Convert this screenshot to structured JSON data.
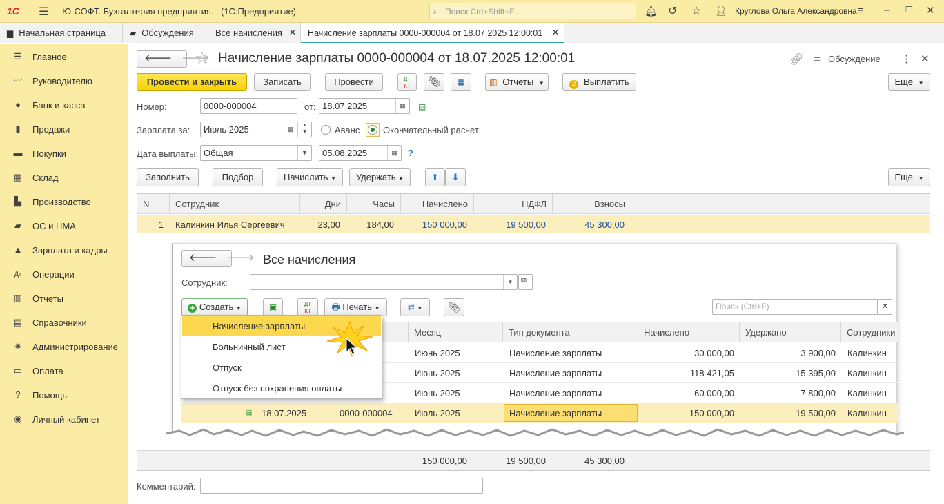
{
  "app": {
    "logo": "1С",
    "title": "Ю-СОФТ. Бухгалтерия предприятия.",
    "platform": "(1С:Предприятие)",
    "search_placeholder": "Поиск Ctrl+Shift+F",
    "user": "Круглова Ольга Александровна"
  },
  "tabs": [
    {
      "label": "Начальная страница"
    },
    {
      "label": "Обсуждения"
    },
    {
      "label": "Все начисления"
    },
    {
      "label": "Начисление зарплаты 0000-000004 от 18.07.2025 12:00:01"
    }
  ],
  "sidebar": {
    "items": [
      {
        "label": "Главное",
        "icon": "menu-icon"
      },
      {
        "label": "Руководителю",
        "icon": "trend-icon"
      },
      {
        "label": "Банк и касса",
        "icon": "coin-icon"
      },
      {
        "label": "Продажи",
        "icon": "bag-icon"
      },
      {
        "label": "Покупки",
        "icon": "cart-icon"
      },
      {
        "label": "Склад",
        "icon": "warehouse-icon"
      },
      {
        "label": "Производство",
        "icon": "factory-icon"
      },
      {
        "label": "ОС и НМА",
        "icon": "truck-icon"
      },
      {
        "label": "Зарплата и кадры",
        "icon": "person-icon"
      },
      {
        "label": "Операции",
        "icon": "dt-kt-icon"
      },
      {
        "label": "Отчеты",
        "icon": "chart-icon"
      },
      {
        "label": "Справочники",
        "icon": "book-icon"
      },
      {
        "label": "Администрирование",
        "icon": "gear-icon"
      },
      {
        "label": "Оплата",
        "icon": "card-icon"
      },
      {
        "label": "Помощь",
        "icon": "question-icon"
      },
      {
        "label": "Личный кабинет",
        "icon": "account-icon"
      }
    ]
  },
  "doc": {
    "title": "Начисление зарплаты 0000-000004 от 18.07.2025 12:00:01",
    "discussion": "Обсуждение",
    "buttons": {
      "post_close": "Провести и закрыть",
      "save": "Записать",
      "post": "Провести",
      "reports": "Отчеты",
      "pay": "Выплатить",
      "more": "Еще"
    },
    "fields": {
      "number_label": "Номер:",
      "number": "0000-000004",
      "date_label": "от:",
      "date": "18.07.2025",
      "salary_for_label": "Зарплата за:",
      "salary_for": "Июль 2025",
      "advance": "Аванс",
      "final_calc": "Окончательный расчет",
      "pay_date_label": "Дата выплаты:",
      "pay_type": "Общая",
      "pay_date": "05.08.2025",
      "help": "?"
    },
    "table_buttons": {
      "fill": "Заполнить",
      "select": "Подбор",
      "accrue": "Начислить",
      "deduct": "Удержать",
      "more": "Еще"
    },
    "columns": [
      "N",
      "Сотрудник",
      "Дни",
      "Часы",
      "Начислено",
      "НДФЛ",
      "Взносы"
    ],
    "rows": [
      {
        "n": "1",
        "employee": "Калинкин Илья Сергеевич",
        "days": "23,00",
        "hours": "184,00",
        "accrued": "150 000,00",
        "ndfl": "19 500,00",
        "contrib": "45 300,00"
      }
    ],
    "totals": {
      "accrued": "150 000,00",
      "ndfl": "19 500,00",
      "contrib": "45 300,00"
    },
    "comment_label": "Комментарий:"
  },
  "overlay": {
    "title": "Все начисления",
    "employee_label": "Сотрудник:",
    "create": "Создать",
    "print": "Печать",
    "search_placeholder": "Поиск (Ctrl+F)",
    "columns": [
      "Месяц",
      "Тип документа",
      "Начислено",
      "Удержано",
      "Сотрудники"
    ],
    "rows": [
      {
        "date": "",
        "number": "",
        "month": "Июнь 2025",
        "type": "Начисление зарплаты",
        "accrued": "30 000,00",
        "withheld": "3 900,00",
        "employees": "Калинкин"
      },
      {
        "date": "",
        "number": "",
        "month": "Июнь 2025",
        "type": "Начисление зарплаты",
        "accrued": "118 421,05",
        "withheld": "15 395,00",
        "employees": "Калинкин"
      },
      {
        "date": "",
        "number": "",
        "month": "Июнь 2025",
        "type": "Начисление зарплаты",
        "accrued": "60 000,00",
        "withheld": "7 800,00",
        "employees": "Калинкин"
      },
      {
        "date": "18.07.2025",
        "number": "0000-000004",
        "month": "Июль 2025",
        "type": "Начисление зарплаты",
        "accrued": "150 000,00",
        "withheld": "19 500,00",
        "employees": "Калинкин"
      }
    ],
    "menu": [
      "Начисление зарплаты",
      "Больничный лист",
      "Отпуск",
      "Отпуск без сохранения оплаты"
    ]
  }
}
